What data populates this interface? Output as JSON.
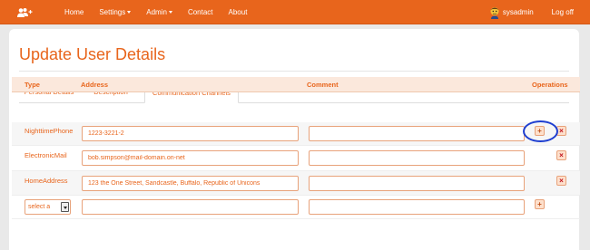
{
  "navbar": {
    "home": "Home",
    "settings": "Settings",
    "admin": "Admin",
    "contact": "Contact",
    "about": "About",
    "username": "sysadmin",
    "logoff": "Log off"
  },
  "page": {
    "title": "Update User Details"
  },
  "tabs": [
    {
      "label": "Personal Details",
      "active": false
    },
    {
      "label": "Description",
      "active": false
    },
    {
      "label": "Communication Channels",
      "active": true
    }
  ],
  "table": {
    "headers": {
      "type": "Type",
      "address": "Address",
      "comment": "Comment",
      "operations": "Operations"
    },
    "rows": [
      {
        "type": "NighttimePhone",
        "address": "1223-3221-2",
        "comment": ""
      },
      {
        "type": "ElectronicMail",
        "address": "bob.simpson@mail-domain.on-net",
        "comment": ""
      },
      {
        "type": "HomeAddress",
        "address": "123 the One Street, Sandcastle, Buffalo, Republic of Unicons",
        "comment": ""
      }
    ],
    "new_row": {
      "select_value": "select a",
      "address": "",
      "comment": ""
    }
  },
  "icons": {
    "users": "users-plus-icon",
    "avatar": "user-avatar-icon",
    "add": "plus-icon",
    "delete": "close-icon"
  },
  "colors": {
    "accent": "#e8651c",
    "highlight": "#1e3ed0"
  }
}
